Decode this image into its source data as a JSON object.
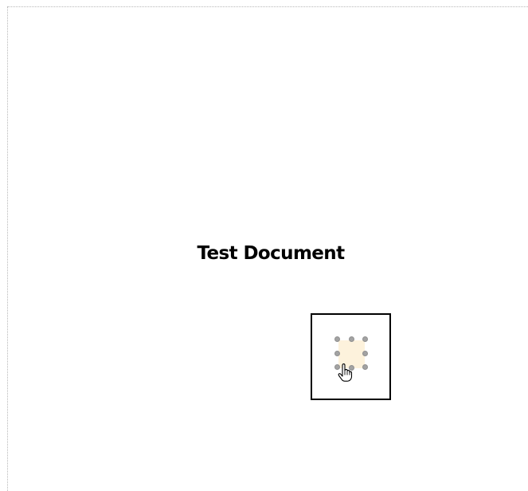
{
  "document": {
    "title": "Test Document"
  },
  "selection": {
    "handles": [
      "top-left",
      "top-center",
      "top-right",
      "middle-left",
      "middle-right",
      "bottom-left",
      "bottom-center",
      "bottom-right"
    ]
  },
  "colors": {
    "shape_fill": "#fdf2dc",
    "handle": "#a3a3a3",
    "page_border": "#b8b8b8"
  },
  "cursor": {
    "icon": "hand-pointer-icon"
  }
}
